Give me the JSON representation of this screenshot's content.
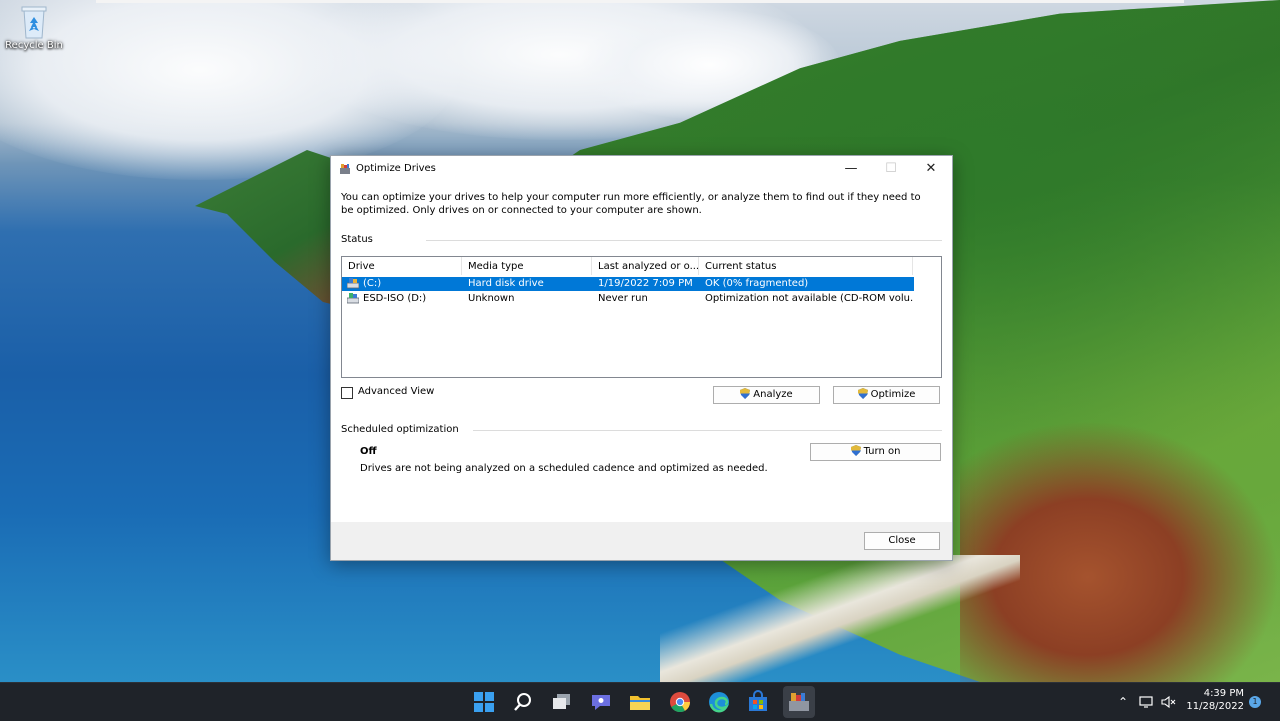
{
  "desktop": {
    "icons": [
      {
        "label": "Recycle Bin",
        "icon": "recycle-bin-icon"
      }
    ]
  },
  "window": {
    "title": "Optimize Drives",
    "icon": "optimize-drives-icon",
    "controls": {
      "minimize": "—",
      "maximize": "☐",
      "close": "✕"
    },
    "intro": "You can optimize your drives to help your computer run more efficiently, or analyze them to find out if they need to be optimized. Only drives on or connected to your computer are shown.",
    "status_section": {
      "label": "Status",
      "columns": [
        "Drive",
        "Media type",
        "Last analyzed or o...",
        "Current status"
      ],
      "rows": [
        {
          "drive": "(C:)",
          "media": "Hard disk drive",
          "last": "1/19/2022 7:09 PM",
          "status": "OK (0% fragmented)",
          "selected": true
        },
        {
          "drive": "ESD-ISO (D:)",
          "media": "Unknown",
          "last": "Never run",
          "status": "Optimization not available (CD-ROM volu...",
          "selected": false
        }
      ]
    },
    "advanced_view_label": "Advanced View",
    "analyze_label": "Analyze",
    "optimize_label": "Optimize",
    "scheduled": {
      "label": "Scheduled optimization",
      "state": "Off",
      "description": "Drives are not being analyzed on a scheduled cadence and optimized as needed.",
      "turn_on_label": "Turn on"
    },
    "close_label": "Close"
  },
  "taskbar": {
    "apps": [
      "start-icon",
      "search-icon",
      "task-view-icon",
      "chat-icon",
      "file-explorer-icon",
      "chrome-icon",
      "edge-icon",
      "store-icon",
      "optimize-drives-icon"
    ],
    "tray": [
      "chevron-up-icon",
      "network-icon",
      "volume-muted-icon"
    ],
    "time": "4:39 PM",
    "date": "11/28/2022",
    "notification_count": "1"
  },
  "colors": {
    "selection": "#0078d7",
    "taskbar": "#1f2329",
    "accent": "#5aa7e8"
  }
}
